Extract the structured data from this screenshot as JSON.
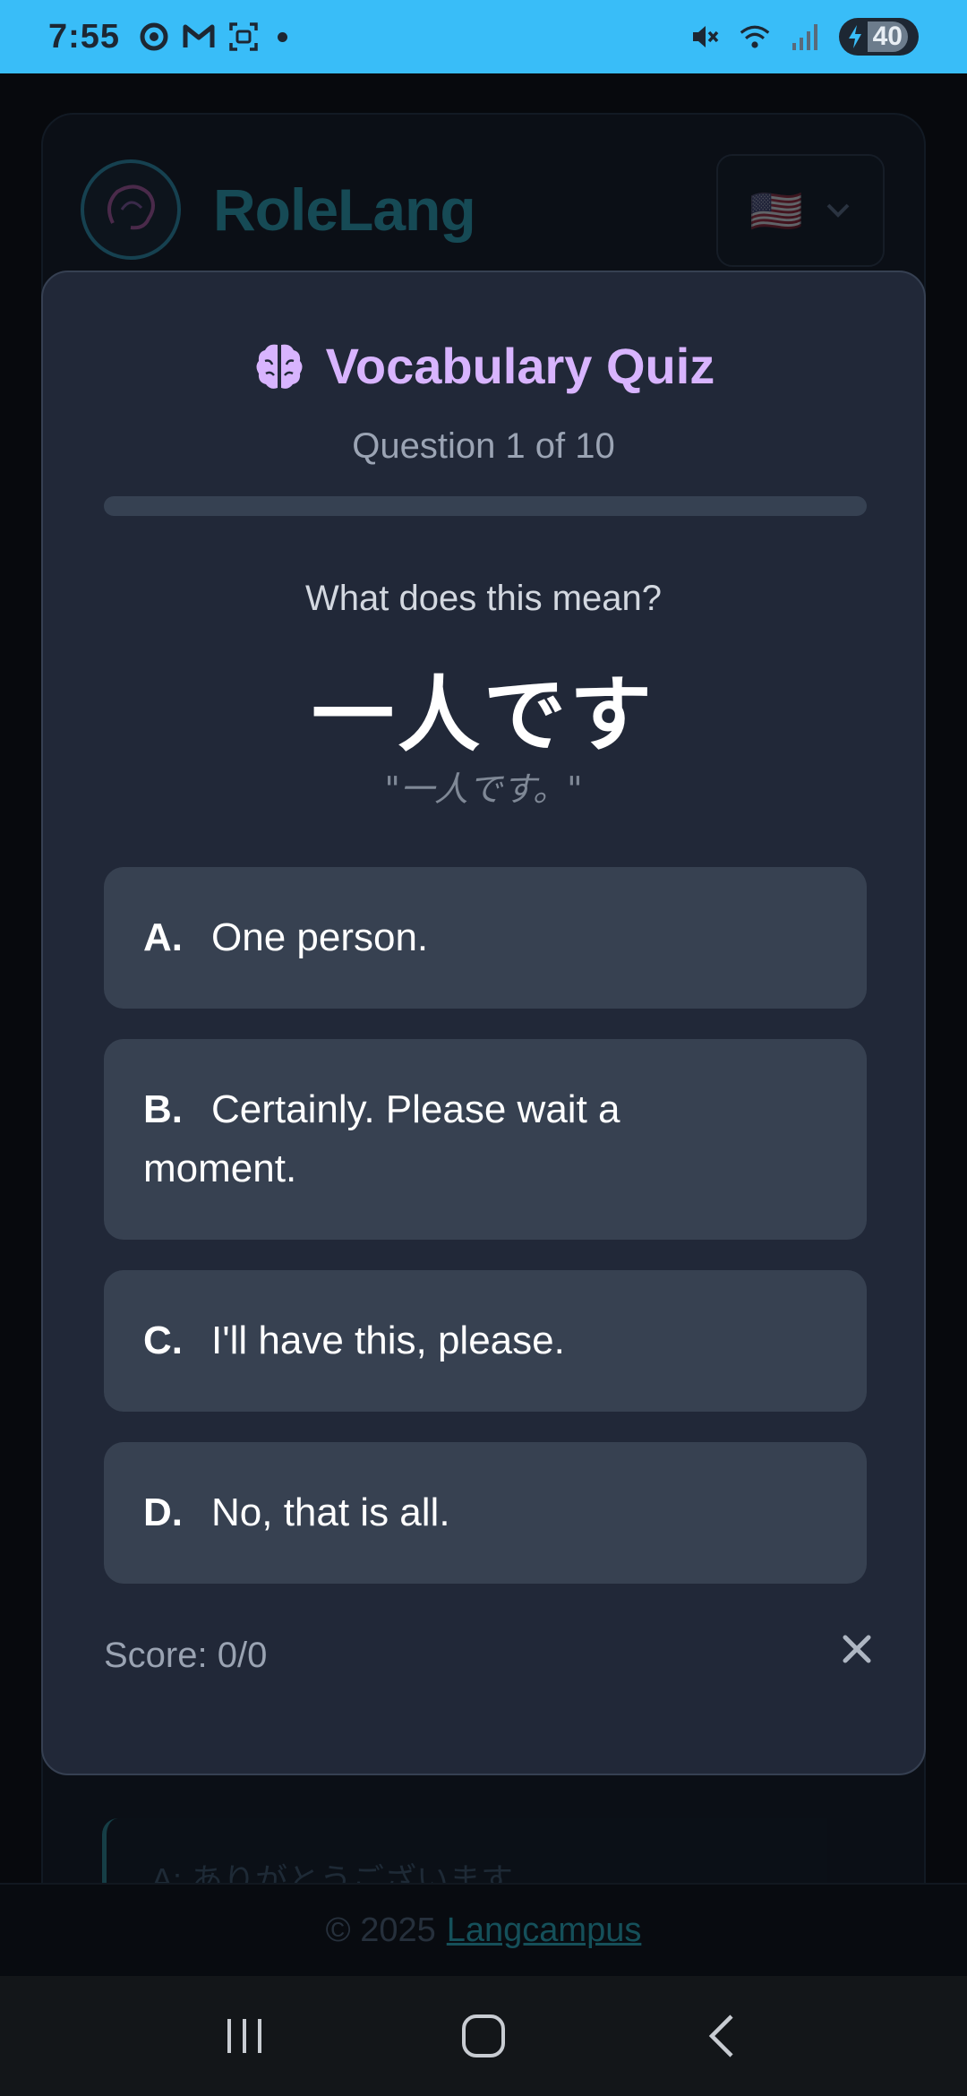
{
  "status_bar": {
    "time": "7:55",
    "battery": "40",
    "icons_left": [
      "chrome-icon",
      "gmail-icon",
      "screenshot-icon"
    ],
    "icons_right": [
      "mute-icon",
      "wifi-icon",
      "signal-icon",
      "battery-charging-icon"
    ]
  },
  "background_app": {
    "brand": "RoleLang",
    "language_flag": "🇺🇸",
    "chat_line": "A: ありがとうございます",
    "footer_prefix": "© 2025",
    "footer_link": "Langcampus"
  },
  "quiz": {
    "title": "Vocabulary Quiz",
    "question_counter": "Question 1 of 10",
    "progress_fraction": 0,
    "prompt": "What does this mean?",
    "term": "一人です",
    "reading": "\"一人です。\"",
    "options": [
      {
        "letter": "A.",
        "text": "One person."
      },
      {
        "letter": "B.",
        "text": "Certainly. Please wait a moment."
      },
      {
        "letter": "C.",
        "text": "I'll have this, please."
      },
      {
        "letter": "D.",
        "text": "No, that is all."
      }
    ],
    "score": "Score: 0/0"
  },
  "colors": {
    "accent_purple": "#d8b4fe",
    "modal_bg": "#212838",
    "option_bg": "#374151",
    "status_bar": "#39bdf8"
  }
}
